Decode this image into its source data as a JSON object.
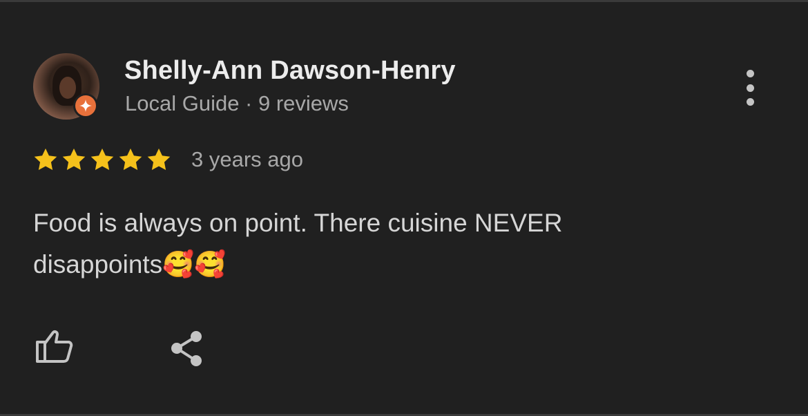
{
  "review": {
    "reviewer_name": "Shelly-Ann Dawson-Henry",
    "reviewer_meta": "Local Guide · 9 reviews",
    "rating": 5,
    "rating_max": 5,
    "time_ago": "3 years ago",
    "text_line1": "Food is always on point. There cuisine NEVER",
    "text_line2": "disappoints🥰🥰"
  },
  "icons": {
    "avatar": "profile-photo",
    "badge": "local-guide-badge-icon",
    "more": "more-vert-icon",
    "star": "star-icon",
    "like": "thumb-up-icon",
    "share": "share-icon"
  },
  "colors": {
    "background": "#202020",
    "star": "#f5c11b",
    "badge": "#e8713b",
    "name": "#ececec",
    "secondary": "#a8a8a8",
    "body": "#d6d6d6",
    "icon": "#c4c4c4"
  }
}
